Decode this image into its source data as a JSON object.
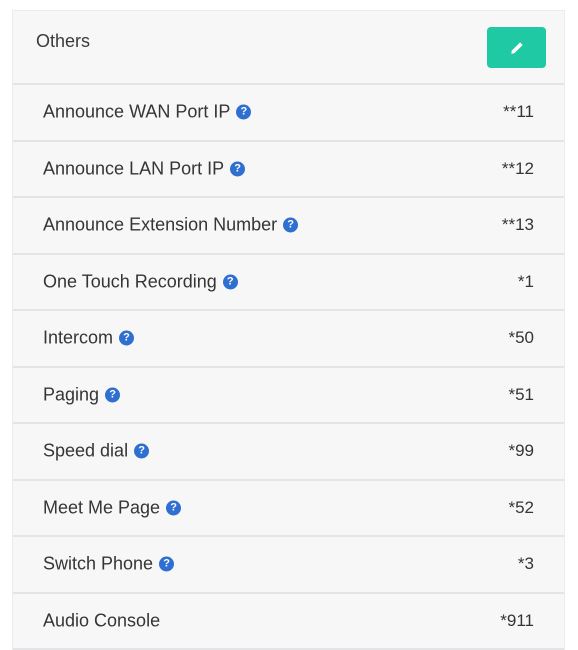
{
  "panel": {
    "title": "Others",
    "edit_icon": "pencil-icon",
    "accent_color": "#1fc9a4",
    "help_icon_color": "#2f6fd0"
  },
  "rows": [
    {
      "label": "Announce WAN Port IP",
      "value": "**11",
      "help": true
    },
    {
      "label": "Announce LAN Port IP",
      "value": "**12",
      "help": true
    },
    {
      "label": "Announce Extension Number",
      "value": "**13",
      "help": true
    },
    {
      "label": "One Touch Recording",
      "value": "*1",
      "help": true
    },
    {
      "label": "Intercom",
      "value": "*50",
      "help": true
    },
    {
      "label": "Paging",
      "value": "*51",
      "help": true
    },
    {
      "label": "Speed dial",
      "value": "*99",
      "help": true
    },
    {
      "label": "Meet Me Page",
      "value": "*52",
      "help": true
    },
    {
      "label": "Switch Phone",
      "value": "*3",
      "help": true
    },
    {
      "label": "Audio Console",
      "value": "*911",
      "help": false
    }
  ]
}
